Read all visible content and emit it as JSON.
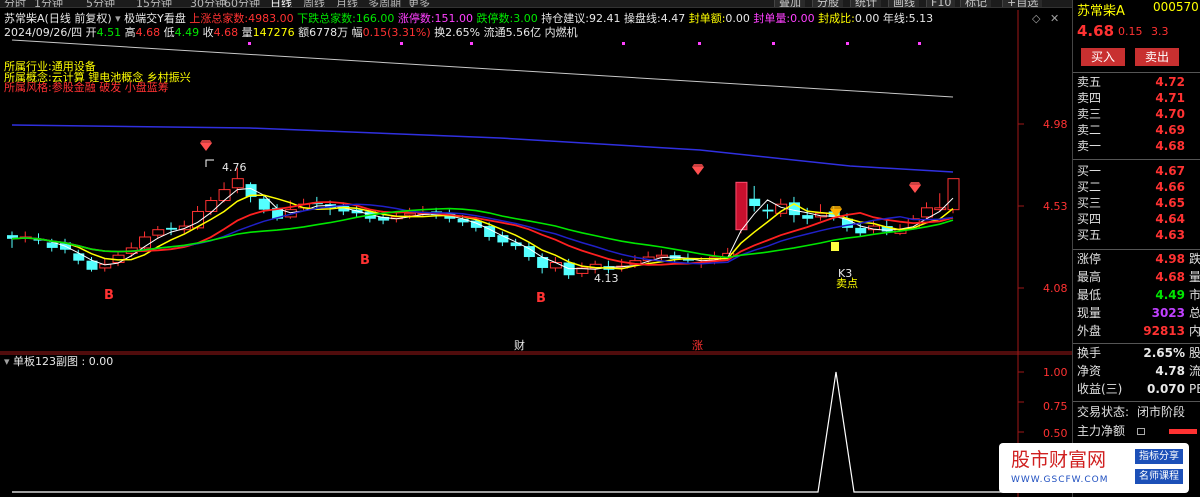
{
  "toolbar": {
    "periods": [
      "分时",
      "1分钟",
      "5分钟",
      "15分钟",
      "30分钟",
      "60分钟",
      "日线",
      "周线",
      "月线",
      "多周期",
      "更多"
    ],
    "active_period": "日线",
    "buttons": [
      "F10",
      "标记",
      "+自选"
    ],
    "buttons_left": [
      "叠加",
      "分股",
      "统计",
      "画线"
    ]
  },
  "header": {
    "stock_name": "苏常柴A",
    "mode": "(日线 前复权)",
    "indicator_name": "极端交Y看盘",
    "up_total_label": "上涨总家数:",
    "up_total_value": "4983.00",
    "down_total_label": "下跌总家数:",
    "down_total_value": "166.00",
    "limit_up_label": "涨停数:",
    "limit_up_value": "151.00",
    "limit_down_label": "跌停数:",
    "limit_down_value": "3.00",
    "position_label": "持仓建议:",
    "position_value": "92.41",
    "trade_line_label": "操盘线:",
    "trade_line_value": "4.47",
    "seal_amount_label": "封单额:",
    "seal_amount_value": "0.00",
    "seal_vol_label": "封单量:",
    "seal_vol_value": "0.00",
    "seal_ratio_label": "封成比:",
    "seal_ratio_value": "0.00",
    "year_line_label": "年线:",
    "year_line_value": "5.13"
  },
  "quote_line": {
    "date": "2024/09/26/四",
    "open_label": "开",
    "open": "4.51",
    "high_label": "高",
    "high": "4.68",
    "low_label": "低",
    "low": "4.49",
    "close_label": "收",
    "close": "4.68",
    "volume_label": "量",
    "volume": "147276",
    "amount_label": "额",
    "amount": "6778万",
    "amp_label": "幅",
    "amp": "0.15(3.31%)",
    "turnover_label": "换",
    "turnover": "2.65%",
    "float_label": "流通",
    "float": "5.56亿",
    "concept": "内燃机"
  },
  "info": {
    "industry_label": "所属行业:",
    "industry": "通用设备",
    "concept_label": "所属概念:",
    "concept": "云计算 锂电池概念 乡村振兴",
    "style_label": "所属风格:",
    "style": "参股金融 破发 小盘蓝筹"
  },
  "chart_labels": {
    "max_label": "4.76",
    "min_label": "4.13",
    "buy_signal": "B",
    "event_cai": "财",
    "event_zhang": "涨",
    "k3_label": "K3",
    "sell_label": "卖点"
  },
  "sub_chart": {
    "title": "单板123副图 : 0.00",
    "y_ticks": [
      "1.00",
      "0.75",
      "0.50"
    ]
  },
  "main_y_ticks": [
    "4.98",
    "4.53",
    "4.08"
  ],
  "colors": {
    "up_candle": "#ff3232",
    "down_candle": "#54ffff",
    "ma_white": "#ffffff",
    "ma_yellow": "#ffff00",
    "ma_green": "#00e600",
    "ma_blue": "#2020c8",
    "ma_red": "#ff2020",
    "year_line": "#c8c8c8"
  },
  "panel": {
    "name": "苏常柴A",
    "code": "000570",
    "price": "4.68",
    "change": "0.15",
    "change_pct": "3.3",
    "buy_btn": "买入",
    "sell_btn": "卖出",
    "sell_book": [
      {
        "label": "卖五",
        "price": "4.72",
        "vol": ""
      },
      {
        "label": "卖四",
        "price": "4.71",
        "vol": ""
      },
      {
        "label": "卖三",
        "price": "4.70",
        "vol": ""
      },
      {
        "label": "卖二",
        "price": "4.69",
        "vol": ""
      },
      {
        "label": "卖一",
        "price": "4.68",
        "vol": ""
      }
    ],
    "buy_book": [
      {
        "label": "买一",
        "price": "4.67",
        "vol": ""
      },
      {
        "label": "买二",
        "price": "4.66",
        "vol": ""
      },
      {
        "label": "买三",
        "price": "4.65",
        "vol": ""
      },
      {
        "label": "买四",
        "price": "4.64",
        "vol": ""
      },
      {
        "label": "买五",
        "price": "4.63",
        "vol": ""
      }
    ],
    "stats": [
      {
        "label": "涨停",
        "value": "4.98",
        "extra": "跌",
        "color": "#ff3232"
      },
      {
        "label": "最高",
        "value": "4.68",
        "extra": "量",
        "color": "#ff3232"
      },
      {
        "label": "最低",
        "value": "4.49",
        "extra": "市",
        "color": "#00e600"
      },
      {
        "label": "现量",
        "value": "3023",
        "extra": "总",
        "color": "#c040ff"
      },
      {
        "label": "外盘",
        "value": "92813",
        "extra": "内",
        "color": "#ff3232"
      }
    ],
    "stats2": [
      {
        "label": "换手",
        "value": "2.65%",
        "extra": "股",
        "color": "#e8e8e8"
      },
      {
        "label": "净资",
        "value": "4.78",
        "extra": "流",
        "color": "#e8e8e8"
      },
      {
        "label": "收益(三)",
        "value": "0.070",
        "extra": "PE",
        "color": "#e8e8e8"
      }
    ],
    "trade_state_label": "交易状态:",
    "trade_state": "闭市阶段",
    "main_flow_label": "主力净额"
  },
  "watermark": {
    "title": "股市财富网",
    "url": "WWW.GSCFW.COM",
    "tag1": "指标分享",
    "tag2": "名师课程"
  }
}
